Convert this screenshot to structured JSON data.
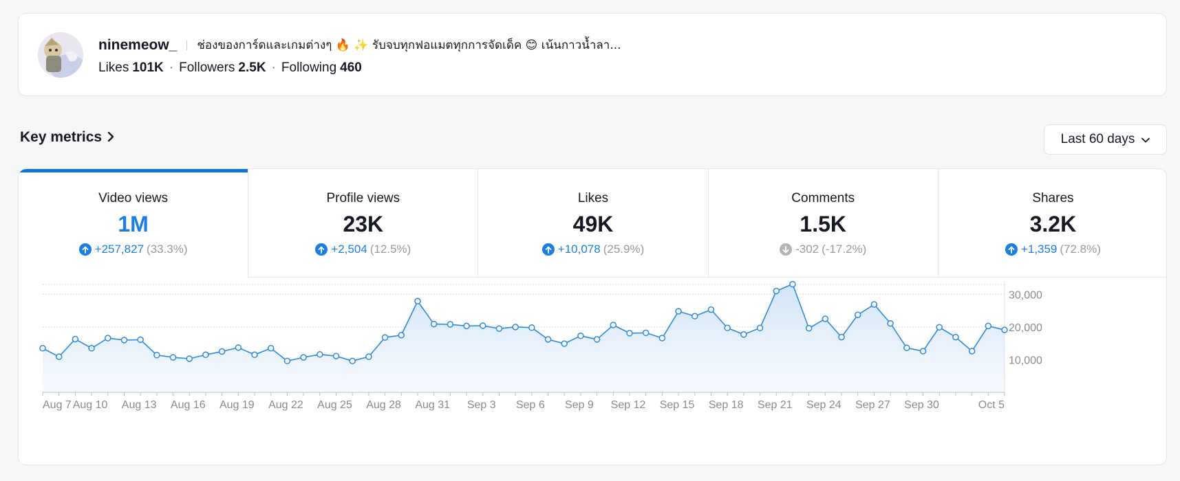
{
  "profile": {
    "username": "ninemeow_",
    "bio": "ช่องของการ์ดและเกมต่างๆ 🔥 ✨ รับจบทุกฟอแมตทุกการจัดเด็ค 😊 เน้นกาวน้ำลา...",
    "stats": [
      {
        "label": "Likes",
        "value": "101K"
      },
      {
        "label": "Followers",
        "value": "2.5K"
      },
      {
        "label": "Following",
        "value": "460"
      }
    ]
  },
  "key_metrics": {
    "title": "Key metrics",
    "range": "Last 60 days"
  },
  "tabs": [
    {
      "label": "Video views",
      "value": "1M",
      "delta": "+257,827",
      "pct": "(33.3%)",
      "dir": "up",
      "active": true
    },
    {
      "label": "Profile views",
      "value": "23K",
      "delta": "+2,504",
      "pct": "(12.5%)",
      "dir": "up",
      "active": false
    },
    {
      "label": "Likes",
      "value": "49K",
      "delta": "+10,078",
      "pct": "(25.9%)",
      "dir": "up",
      "active": false
    },
    {
      "label": "Comments",
      "value": "1.5K",
      "delta": "-302",
      "pct": "(-17.2%)",
      "dir": "down",
      "active": false
    },
    {
      "label": "Shares",
      "value": "3.2K",
      "delta": "+1,359",
      "pct": "(72.8%)",
      "dir": "up",
      "active": false
    }
  ],
  "colors": {
    "accent": "#1a7fe0",
    "line": "#2b8ae0",
    "down": "#b5b5b5"
  },
  "chart_data": {
    "type": "area",
    "series": [
      {
        "name": "Video views",
        "x_start": "Aug 7",
        "values": [
          13500,
          10900,
          16300,
          13500,
          16600,
          16000,
          16100,
          11400,
          10700,
          10300,
          11500,
          12500,
          13700,
          11500,
          13500,
          9600,
          10700,
          11600,
          11100,
          9600,
          10900,
          16800,
          17500,
          27900,
          20900,
          20800,
          20300,
          20400,
          19500,
          20000,
          19800,
          16200,
          14900,
          17300,
          16200,
          20600,
          18100,
          18200,
          16600,
          24800,
          23300,
          25300,
          19700,
          17700,
          19700,
          31000,
          33100,
          19600,
          22500,
          16900,
          23700,
          26900,
          21100,
          13600,
          12600,
          19900,
          16900,
          12600,
          20300,
          19100
        ]
      }
    ],
    "x_ticks": [
      "Aug 7",
      "Aug 10",
      "Aug 13",
      "Aug 16",
      "Aug 19",
      "Aug 22",
      "Aug 25",
      "Aug 28",
      "Aug 31",
      "Sep 3",
      "Sep 6",
      "Sep 9",
      "Sep 12",
      "Sep 15",
      "Sep 18",
      "Sep 21",
      "Sep 24",
      "Sep 27",
      "Sep 30",
      "Oct 5"
    ],
    "y_ticks": [
      "10,000",
      "20,000",
      "30,000"
    ],
    "y_tick_values": [
      10000,
      20000,
      30000
    ],
    "ylim": [
      0,
      33000
    ],
    "grid": true
  }
}
